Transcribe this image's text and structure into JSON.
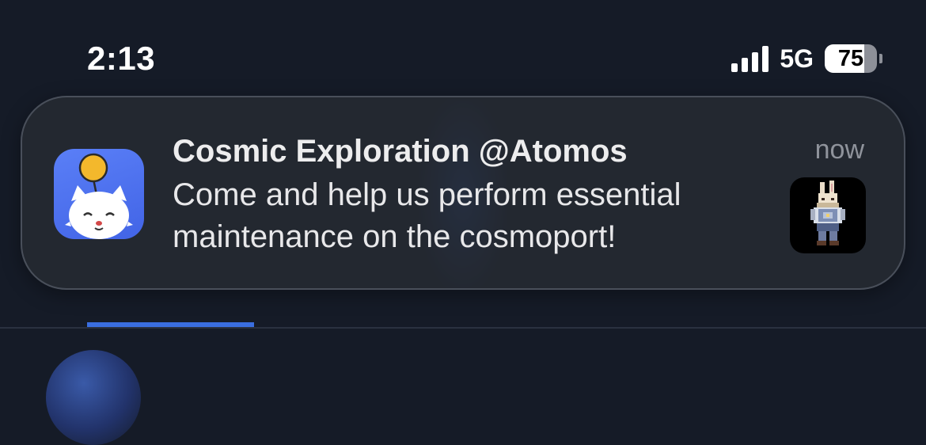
{
  "status_bar": {
    "time": "2:13",
    "network": "5G",
    "battery": "75",
    "battery_level": 0.75,
    "signal_bars": 4
  },
  "notification": {
    "title": "Cosmic Exploration @Atomos",
    "time": "now",
    "body": "Come and help us perform essential maintenance on the cosmoport!",
    "app_icon": "moogle-app-icon",
    "thumbnail": "bunny-character-thumbnail"
  },
  "colors": {
    "app_icon_bg": "#4a6ef0",
    "tab_indicator": "#3a6ee0",
    "background": "#151b27"
  }
}
